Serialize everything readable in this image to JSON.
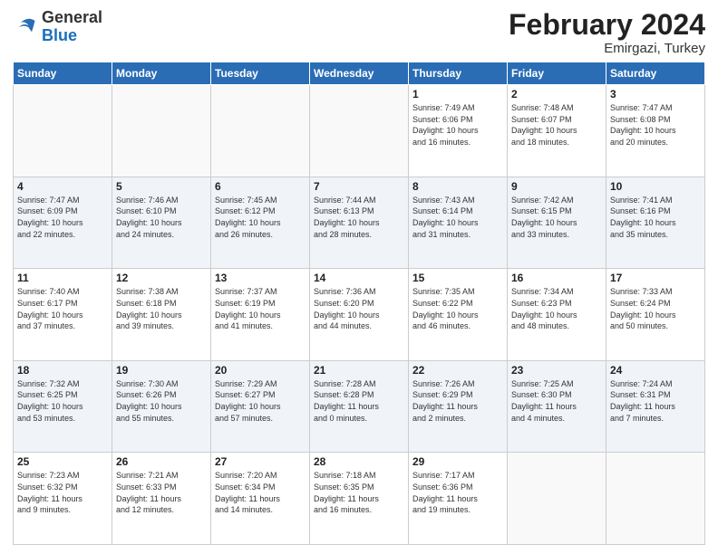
{
  "header": {
    "logo": {
      "line1": "General",
      "line2": "Blue"
    },
    "title": "February 2024",
    "location": "Emirgazi, Turkey"
  },
  "weekdays": [
    "Sunday",
    "Monday",
    "Tuesday",
    "Wednesday",
    "Thursday",
    "Friday",
    "Saturday"
  ],
  "rows": [
    {
      "cells": [
        {
          "day": "",
          "info": ""
        },
        {
          "day": "",
          "info": ""
        },
        {
          "day": "",
          "info": ""
        },
        {
          "day": "",
          "info": ""
        },
        {
          "day": "1",
          "info": "Sunrise: 7:49 AM\nSunset: 6:06 PM\nDaylight: 10 hours\nand 16 minutes."
        },
        {
          "day": "2",
          "info": "Sunrise: 7:48 AM\nSunset: 6:07 PM\nDaylight: 10 hours\nand 18 minutes."
        },
        {
          "day": "3",
          "info": "Sunrise: 7:47 AM\nSunset: 6:08 PM\nDaylight: 10 hours\nand 20 minutes."
        }
      ]
    },
    {
      "cells": [
        {
          "day": "4",
          "info": "Sunrise: 7:47 AM\nSunset: 6:09 PM\nDaylight: 10 hours\nand 22 minutes."
        },
        {
          "day": "5",
          "info": "Sunrise: 7:46 AM\nSunset: 6:10 PM\nDaylight: 10 hours\nand 24 minutes."
        },
        {
          "day": "6",
          "info": "Sunrise: 7:45 AM\nSunset: 6:12 PM\nDaylight: 10 hours\nand 26 minutes."
        },
        {
          "day": "7",
          "info": "Sunrise: 7:44 AM\nSunset: 6:13 PM\nDaylight: 10 hours\nand 28 minutes."
        },
        {
          "day": "8",
          "info": "Sunrise: 7:43 AM\nSunset: 6:14 PM\nDaylight: 10 hours\nand 31 minutes."
        },
        {
          "day": "9",
          "info": "Sunrise: 7:42 AM\nSunset: 6:15 PM\nDaylight: 10 hours\nand 33 minutes."
        },
        {
          "day": "10",
          "info": "Sunrise: 7:41 AM\nSunset: 6:16 PM\nDaylight: 10 hours\nand 35 minutes."
        }
      ]
    },
    {
      "cells": [
        {
          "day": "11",
          "info": "Sunrise: 7:40 AM\nSunset: 6:17 PM\nDaylight: 10 hours\nand 37 minutes."
        },
        {
          "day": "12",
          "info": "Sunrise: 7:38 AM\nSunset: 6:18 PM\nDaylight: 10 hours\nand 39 minutes."
        },
        {
          "day": "13",
          "info": "Sunrise: 7:37 AM\nSunset: 6:19 PM\nDaylight: 10 hours\nand 41 minutes."
        },
        {
          "day": "14",
          "info": "Sunrise: 7:36 AM\nSunset: 6:20 PM\nDaylight: 10 hours\nand 44 minutes."
        },
        {
          "day": "15",
          "info": "Sunrise: 7:35 AM\nSunset: 6:22 PM\nDaylight: 10 hours\nand 46 minutes."
        },
        {
          "day": "16",
          "info": "Sunrise: 7:34 AM\nSunset: 6:23 PM\nDaylight: 10 hours\nand 48 minutes."
        },
        {
          "day": "17",
          "info": "Sunrise: 7:33 AM\nSunset: 6:24 PM\nDaylight: 10 hours\nand 50 minutes."
        }
      ]
    },
    {
      "cells": [
        {
          "day": "18",
          "info": "Sunrise: 7:32 AM\nSunset: 6:25 PM\nDaylight: 10 hours\nand 53 minutes."
        },
        {
          "day": "19",
          "info": "Sunrise: 7:30 AM\nSunset: 6:26 PM\nDaylight: 10 hours\nand 55 minutes."
        },
        {
          "day": "20",
          "info": "Sunrise: 7:29 AM\nSunset: 6:27 PM\nDaylight: 10 hours\nand 57 minutes."
        },
        {
          "day": "21",
          "info": "Sunrise: 7:28 AM\nSunset: 6:28 PM\nDaylight: 11 hours\nand 0 minutes."
        },
        {
          "day": "22",
          "info": "Sunrise: 7:26 AM\nSunset: 6:29 PM\nDaylight: 11 hours\nand 2 minutes."
        },
        {
          "day": "23",
          "info": "Sunrise: 7:25 AM\nSunset: 6:30 PM\nDaylight: 11 hours\nand 4 minutes."
        },
        {
          "day": "24",
          "info": "Sunrise: 7:24 AM\nSunset: 6:31 PM\nDaylight: 11 hours\nand 7 minutes."
        }
      ]
    },
    {
      "cells": [
        {
          "day": "25",
          "info": "Sunrise: 7:23 AM\nSunset: 6:32 PM\nDaylight: 11 hours\nand 9 minutes."
        },
        {
          "day": "26",
          "info": "Sunrise: 7:21 AM\nSunset: 6:33 PM\nDaylight: 11 hours\nand 12 minutes."
        },
        {
          "day": "27",
          "info": "Sunrise: 7:20 AM\nSunset: 6:34 PM\nDaylight: 11 hours\nand 14 minutes."
        },
        {
          "day": "28",
          "info": "Sunrise: 7:18 AM\nSunset: 6:35 PM\nDaylight: 11 hours\nand 16 minutes."
        },
        {
          "day": "29",
          "info": "Sunrise: 7:17 AM\nSunset: 6:36 PM\nDaylight: 11 hours\nand 19 minutes."
        },
        {
          "day": "",
          "info": ""
        },
        {
          "day": "",
          "info": ""
        }
      ]
    }
  ]
}
